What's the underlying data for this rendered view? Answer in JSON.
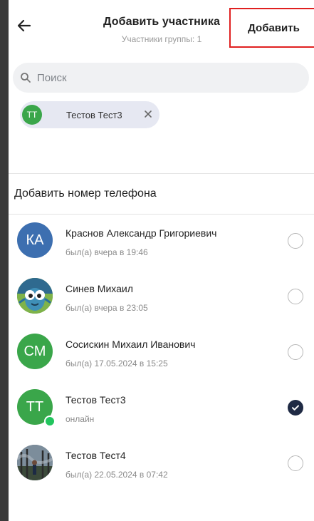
{
  "header": {
    "title": "Добавить участника",
    "subtitle": "Участники группы: 1",
    "add_button": "Добавить"
  },
  "search": {
    "placeholder": "Поиск"
  },
  "selected_chip": {
    "initials": "ТТ",
    "name": "Тестов Тест3"
  },
  "add_phone_label": "Добавить номер телефона",
  "contacts": [
    {
      "name": "Краснов Александр Григориевич",
      "status": "был(а) вчера в 19:46",
      "initials": "КА",
      "avatar_color": "#3d6fb0",
      "checked": false
    },
    {
      "name": "Синев Михаил",
      "status": "был(а) вчера в 23:05",
      "initials": "",
      "avatar_type": "cartoon-photo",
      "checked": false
    },
    {
      "name": "Сосискин Михаил Иванович",
      "status": "был(а) 17.05.2024 в 15:25",
      "initials": "СМ",
      "avatar_color": "#3aa64a",
      "checked": false
    },
    {
      "name": "Тестов Тест3",
      "status": "онлайн",
      "initials": "ТТ",
      "avatar_color": "#3aa64a",
      "online": true,
      "checked": true
    },
    {
      "name": "Тестов Тест4",
      "status": "был(а) 22.05.2024 в 07:42",
      "initials": "",
      "avatar_type": "forest-photo",
      "checked": false
    }
  ],
  "colors": {
    "accent_dark": "#1f2a44",
    "green": "#3aa64a",
    "online": "#22c55e",
    "highlight": "#e02020"
  }
}
